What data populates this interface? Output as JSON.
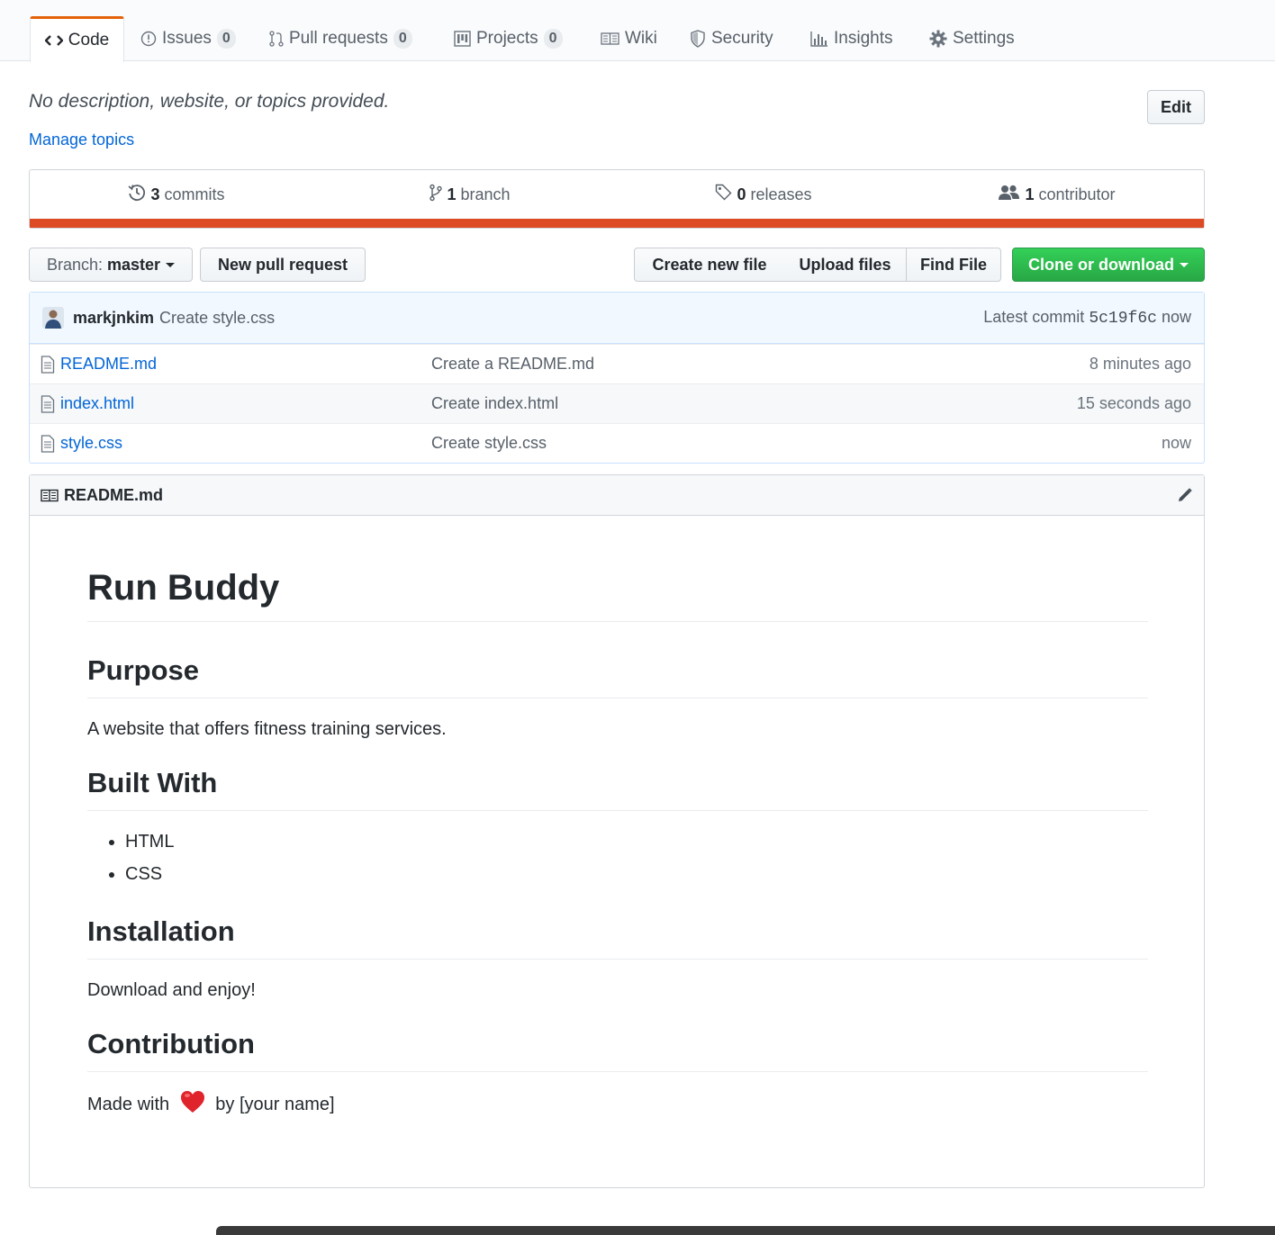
{
  "tabs": [
    {
      "label": "Code",
      "icon": "code-icon",
      "selected": true
    },
    {
      "label": "Issues",
      "count": "0",
      "icon": "issue-icon"
    },
    {
      "label": "Pull requests",
      "count": "0",
      "icon": "pull-request-icon"
    },
    {
      "label": "Projects",
      "count": "0",
      "icon": "project-icon"
    },
    {
      "label": "Wiki",
      "icon": "book-icon"
    },
    {
      "label": "Security",
      "icon": "shield-icon"
    },
    {
      "label": "Insights",
      "icon": "graph-icon"
    },
    {
      "label": "Settings",
      "icon": "gear-icon"
    }
  ],
  "repo": {
    "description": "No description, website, or topics provided.",
    "manage_topics": "Manage topics",
    "edit_label": "Edit"
  },
  "summary": {
    "commits_count": "3",
    "commits_label": "commits",
    "branch_count": "1",
    "branch_label": "branch",
    "releases_count": "0",
    "releases_label": "releases",
    "contributors_count": "1",
    "contributors_label": "contributor",
    "language_color": "#dd4b25"
  },
  "toolbar": {
    "branch_prefix": "Branch:",
    "branch_name": "master",
    "new_pull_request": "New pull request",
    "create_new_file": "Create new file",
    "upload_files": "Upload files",
    "find_file": "Find File",
    "clone_or_download": "Clone or download"
  },
  "latest_commit": {
    "user": "markjnkim",
    "message": "Create style.css",
    "prefix": "Latest commit",
    "sha": "5c19f6c",
    "time": "now"
  },
  "files": [
    {
      "name": "README.md",
      "message": "Create a README.md",
      "age": "8 minutes ago"
    },
    {
      "name": "index.html",
      "message": "Create index.html",
      "age": "15 seconds ago"
    },
    {
      "name": "style.css",
      "message": "Create style.css",
      "age": "now"
    }
  ],
  "readme": {
    "filename": "README.md",
    "title": "Run Buddy",
    "purpose_heading": "Purpose",
    "purpose_text": "A website that offers fitness training services.",
    "built_heading": "Built With",
    "built_items": [
      "HTML",
      "CSS"
    ],
    "install_heading": "Installation",
    "install_text": "Download and enjoy!",
    "contrib_heading": "Contribution",
    "contrib_prefix": "Made with",
    "contrib_suffix": "by [your name]"
  },
  "colors": {
    "link": "#0366d6",
    "accent_tab": "#e36209",
    "clone_button": "#28a745",
    "heart": "#e0242b"
  }
}
